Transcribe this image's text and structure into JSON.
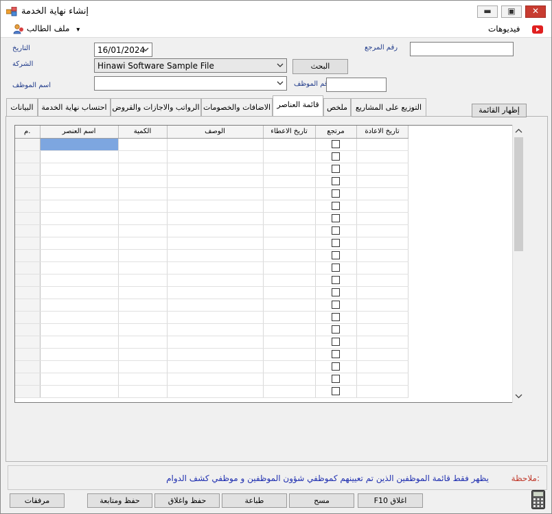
{
  "window": {
    "title": "إنشاء نهاية الخدمة",
    "minimize": "▬",
    "maximize": "▣",
    "close": "✕"
  },
  "menubar": {
    "videos": "فيديوهات",
    "applicant_file": "ملف الطالب",
    "dropdown_arrow": "▾"
  },
  "form": {
    "reference_label": "رقم المرجع",
    "reference_value": "",
    "date_label": "التاريخ",
    "date_value": "16/01/2024",
    "company_label": "الشركة",
    "company_value": "Hinawi Software Sample File",
    "search_button": "البحث",
    "employee_number_label": "رقم الموظف",
    "employee_number_value": "",
    "employee_name_label": "اسم الموظف",
    "employee_name_value": ""
  },
  "tabs": [
    {
      "label": "التوزيع على المشاريع"
    },
    {
      "label": "ملخص"
    },
    {
      "label": "قائمة العناصر"
    },
    {
      "label": "الاضافات والخصومات"
    },
    {
      "label": "الرواتب والاجازات والقروض"
    },
    {
      "label": "احتساب نهاية الخدمة"
    },
    {
      "label": "البيانات"
    }
  ],
  "show_list_button": "إظهار القائمة",
  "grid": {
    "columns": [
      "تاريخ الاعادة",
      "مرتجع",
      "تاريخ الاعطاء",
      "الوصف",
      "الكمية",
      "اسم العنصر",
      "م."
    ],
    "empty_rows": 21
  },
  "note": {
    "label": "ملاحظة:",
    "text": "يظهر فقط قائمة الموظفين الذين تم تعيينهم كموظفي شؤون الموظفين و موظفي كشف الدوام"
  },
  "footer": {
    "close": "F10 اغلاق",
    "clear": "مسح",
    "print": "طباعة",
    "save_close": "حفظ واغلاق",
    "save_continue": "حفظ ومتابعة",
    "attachments": "مرفقات"
  },
  "colors": {
    "label_blue": "#1f3a8a",
    "note_red": "#c0392b",
    "note_blue": "#1f2fb0",
    "close_red": "#c83b30",
    "selection_blue": "#7da6e0"
  }
}
